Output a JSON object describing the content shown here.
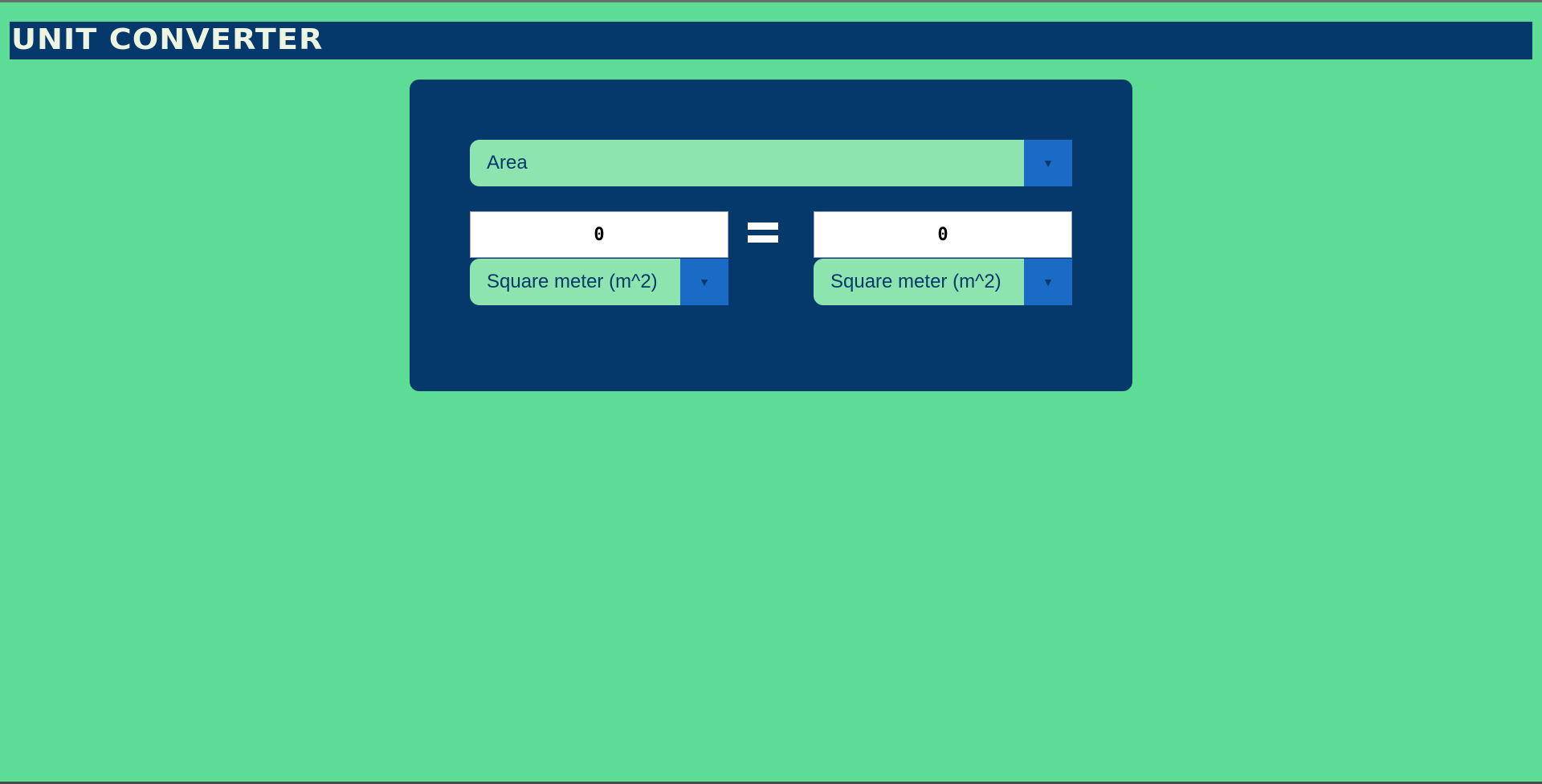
{
  "header": {
    "title": "UNIT CONVERTER"
  },
  "converter": {
    "category": {
      "selected": "Area",
      "arrow_icon": "triangle-down-icon"
    },
    "from": {
      "value": "0",
      "unit": "Square meter (m^2)"
    },
    "to": {
      "value": "0",
      "unit": "Square meter (m^2)"
    },
    "equals_icon": "equals-sign-icon"
  },
  "colors": {
    "background": "#5cdc94",
    "panel": "#05386b",
    "select_fill": "#8ee4af",
    "arrow_fill": "#1a6bc5",
    "title_text": "#edf5e1"
  }
}
